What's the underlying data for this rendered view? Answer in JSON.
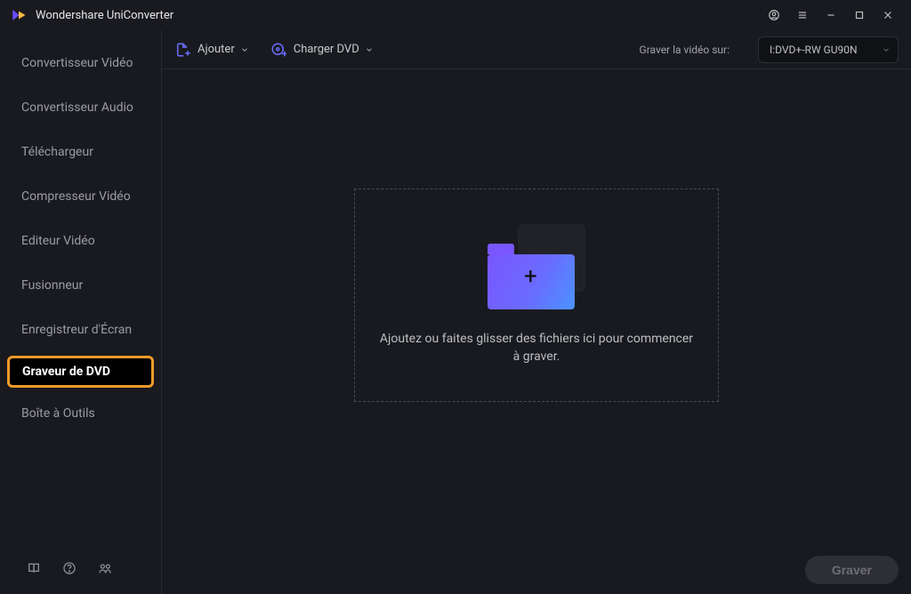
{
  "app": {
    "name": "Wondershare UniConverter"
  },
  "sidebar": {
    "items": [
      {
        "label": "Convertisseur Vidéo"
      },
      {
        "label": "Convertisseur Audio"
      },
      {
        "label": "Téléchargeur"
      },
      {
        "label": "Compresseur Vidéo"
      },
      {
        "label": "Editeur Vidéo"
      },
      {
        "label": "Fusionneur"
      },
      {
        "label": "Enregistreur d'Écran"
      },
      {
        "label": "Graveur de DVD"
      },
      {
        "label": "Boîte à Outils"
      }
    ],
    "active_index": 7
  },
  "toolbar": {
    "add_label": "Ajouter",
    "load_dvd_label": "Charger DVD",
    "burn_on_label": "Graver la vidéo sur:",
    "burn_target": "I:DVD+-RW GU90N"
  },
  "dropzone": {
    "hint": "Ajoutez ou faites glisser des fichiers ici pour commencer à graver."
  },
  "footer": {
    "burn_button": "Graver"
  }
}
